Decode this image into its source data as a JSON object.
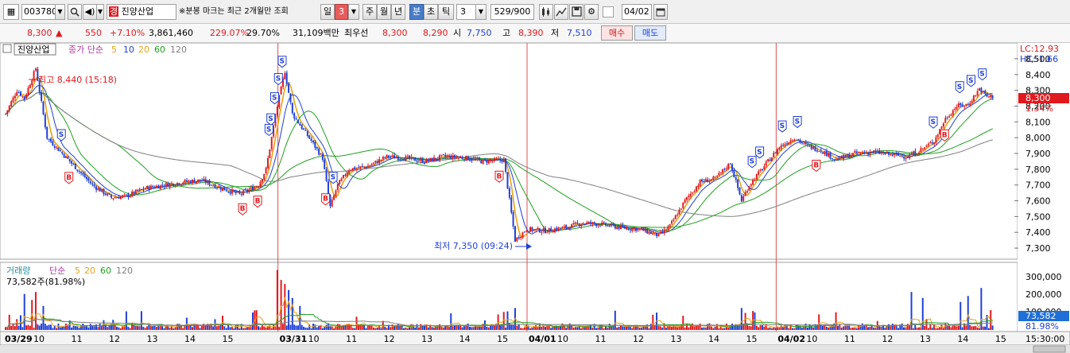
{
  "toolbar": {
    "stock_code": "003780",
    "stock_badge": "경",
    "stock_name": "진양산업",
    "notice": "※분봉 마크는 최근 2개월만 조회",
    "period_tabs": [
      "일",
      "3",
      "주",
      "월",
      "년",
      "분",
      "초",
      "틱"
    ],
    "active_period_tabs": [
      "3",
      "분"
    ],
    "tick_interval": "3",
    "page_counter": "529/900",
    "date_value": "04/02"
  },
  "quote": {
    "price": "8,300",
    "change_arrow": "▲",
    "change": "550",
    "change_pct": "+7.10%",
    "volume": "3,861,460",
    "volume_ratio": "229.07%",
    "turnover": "29.70%",
    "amount": "31,109백만",
    "best_label": "최우선",
    "best_ask": "8,300",
    "best_bid": "8,290",
    "open_label": "시",
    "open": "7,750",
    "high_label": "고",
    "high": "8,390",
    "low_label": "저",
    "low": "7,510",
    "buy_label": "매수",
    "sell_label": "매도"
  },
  "price_panel": {
    "stock_label": "진양산업",
    "indicator_label": "종가 단순",
    "ma_periods": [
      "5",
      "10",
      "20",
      "60",
      "120"
    ],
    "lc_label": "LC:12.93",
    "hc_label": "HC:-1.66",
    "y_ticks": [
      "8,500",
      "8,400",
      "8,300",
      "8,200",
      "8,100",
      "8,000",
      "7,900",
      "7,800",
      "7,700",
      "7,600",
      "7,500",
      "7,400",
      "7,300"
    ],
    "current_price_tag": "8,300",
    "current_pct_tag": "1.34%",
    "high_annotation": "최고 8,440 (15:18)",
    "low_annotation": "최저 7,350 (09:24)",
    "signal_buy": "B",
    "signal_sell": "S"
  },
  "volume_panel": {
    "title": "거래량",
    "indicator_label": "단순",
    "ma_periods": [
      "5",
      "20",
      "60",
      "120"
    ],
    "value_label": "73,582주(81.98%)",
    "y_ticks": [
      "300,000",
      "200,000",
      "100,000"
    ],
    "current_tag": "73,582",
    "current_pct": "81.98%"
  },
  "x_axis": {
    "labels": [
      "03/29",
      "10",
      "11",
      "12",
      "13",
      "14",
      "15",
      "03/31",
      "10",
      "11",
      "12",
      "13",
      "14",
      "15",
      "04/01",
      "10",
      "11",
      "12",
      "13",
      "14",
      "15",
      "04/02",
      "10",
      "11",
      "12",
      "13",
      "14",
      "15"
    ],
    "time_label": "15:30:00"
  },
  "colors": {
    "up": "#e0191e",
    "down": "#1f3fd6",
    "ma5": "#e8a317",
    "ma10": "#1f3fd6",
    "ma20": "#1fa01f",
    "ma60": "#7f7f7f",
    "accent": "#4a7cc7"
  },
  "chart_data": {
    "type": "candlestick",
    "y_range": [
      7250,
      8560
    ],
    "sessions": [
      "03/29",
      "03/31",
      "04/01",
      "04/02"
    ],
    "key_price_path": [
      [
        0,
        8150
      ],
      [
        6,
        8300
      ],
      [
        10,
        8250
      ],
      [
        16,
        8440
      ],
      [
        22,
        8000
      ],
      [
        30,
        7900
      ],
      [
        38,
        7800
      ],
      [
        46,
        7700
      ],
      [
        56,
        7620
      ],
      [
        64,
        7630
      ],
      [
        74,
        7680
      ],
      [
        84,
        7700
      ],
      [
        94,
        7720
      ],
      [
        104,
        7730
      ],
      [
        114,
        7680
      ],
      [
        124,
        7640
      ],
      [
        134,
        7700
      ],
      [
        138,
        7800
      ],
      [
        144,
        8200
      ],
      [
        148,
        8420
      ],
      [
        152,
        8150
      ],
      [
        156,
        8080
      ],
      [
        162,
        7980
      ],
      [
        168,
        7870
      ],
      [
        172,
        7560
      ],
      [
        176,
        7700
      ],
      [
        182,
        7800
      ],
      [
        192,
        7820
      ],
      [
        202,
        7880
      ],
      [
        212,
        7870
      ],
      [
        222,
        7850
      ],
      [
        232,
        7880
      ],
      [
        244,
        7870
      ],
      [
        252,
        7850
      ],
      [
        264,
        7860
      ],
      [
        270,
        7350
      ],
      [
        276,
        7420
      ],
      [
        286,
        7410
      ],
      [
        296,
        7430
      ],
      [
        306,
        7460
      ],
      [
        316,
        7450
      ],
      [
        326,
        7430
      ],
      [
        336,
        7420
      ],
      [
        346,
        7380
      ],
      [
        352,
        7440
      ],
      [
        360,
        7600
      ],
      [
        368,
        7720
      ],
      [
        376,
        7740
      ],
      [
        384,
        7840
      ],
      [
        390,
        7600
      ],
      [
        394,
        7700
      ],
      [
        400,
        7790
      ],
      [
        410,
        7940
      ],
      [
        418,
        8000
      ],
      [
        424,
        7950
      ],
      [
        432,
        7920
      ],
      [
        440,
        7860
      ],
      [
        450,
        7900
      ],
      [
        460,
        7910
      ],
      [
        470,
        7890
      ],
      [
        478,
        7880
      ],
      [
        486,
        7930
      ],
      [
        492,
        7980
      ],
      [
        498,
        8120
      ],
      [
        504,
        8200
      ],
      [
        510,
        8210
      ],
      [
        516,
        8310
      ],
      [
        520,
        8260
      ]
    ]
  }
}
